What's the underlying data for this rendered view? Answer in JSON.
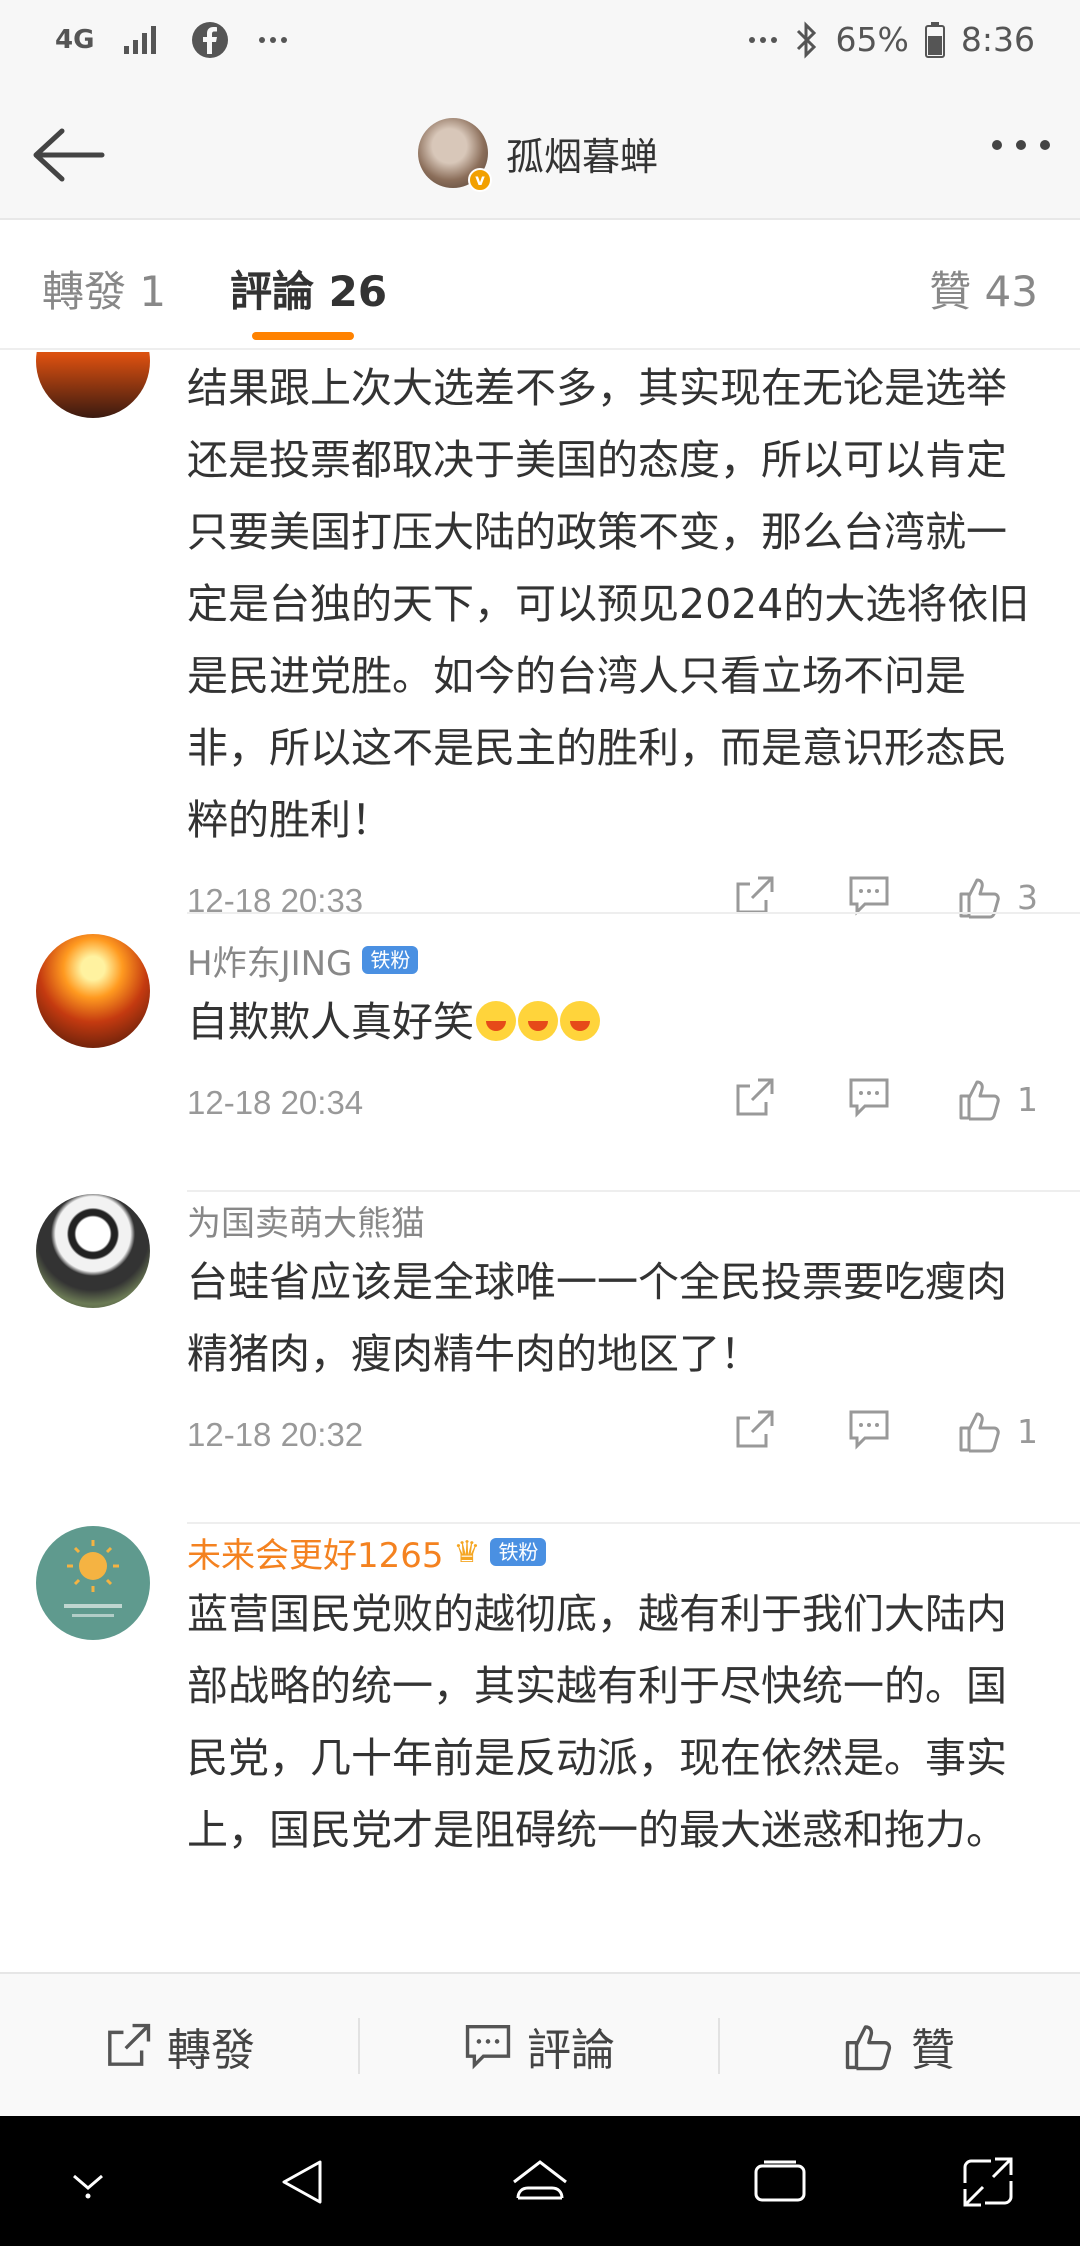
{
  "status_bar": {
    "network": "4G",
    "battery": "65%",
    "time": "8:36",
    "icons": [
      "signal-icon",
      "facebook-icon",
      "more-dots-icon",
      "bluetooth-icon",
      "battery-icon"
    ]
  },
  "header": {
    "title": "孤烟暮蝉",
    "verified_icon": "v-badge"
  },
  "tabs": [
    {
      "label": "轉發 1"
    },
    {
      "label": "評論 26"
    },
    {
      "label": "贊 43"
    }
  ],
  "comments": [
    {
      "name": "",
      "text": "结果跟上次大选差不多，其实现在无论是选举还是投票都取决于美国的态度，所以可以肯定只要美国打压大陆的政策不变，那么台湾就一定是台独的天下，可以预见2024的大选将依旧是民进党胜。如今的台湾人只看立场不问是非，所以这不是民主的胜利，而是意识形态民粹的胜利！",
      "time": "12-18 20:33",
      "likes": "3"
    },
    {
      "name": "H炸东JING",
      "badge": "铁粉",
      "text": "自欺欺人真好笑",
      "time": "12-18 20:34",
      "likes": "1"
    },
    {
      "name": "为国卖萌大熊猫",
      "text": "台蛙省应该是全球唯一一个全民投票要吃瘦肉精猪肉，瘦肉精牛肉的地区了！",
      "time": "12-18 20:32",
      "likes": "1"
    },
    {
      "name": "未来会更好1265",
      "badge": "铁粉",
      "text": "蓝营国民党败的越彻底，越有利于我们大陆内部战略的统一，其实越有利于尽快统一的。国民党，几十年前是反动派，现在依然是。事实上，国民党才是阻碍统一的最大迷惑和拖力。"
    }
  ],
  "bottom_bar": {
    "repost": "轉發",
    "comment": "評論",
    "like": "贊"
  },
  "colors": {
    "accent": "#ff8200",
    "gold_name": "#f48220",
    "badge_blue": "#4a90e2"
  }
}
